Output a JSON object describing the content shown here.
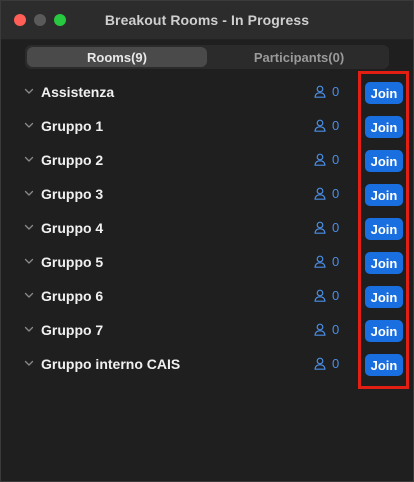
{
  "window": {
    "title": "Breakout Rooms - In Progress"
  },
  "tabs": [
    {
      "label": "Rooms(9)",
      "active": true
    },
    {
      "label": "Participants(0)",
      "active": false
    }
  ],
  "rooms": [
    {
      "name": "Assistenza",
      "count": "0",
      "join_label": "Join"
    },
    {
      "name": "Gruppo 1",
      "count": "0",
      "join_label": "Join"
    },
    {
      "name": "Gruppo 2",
      "count": "0",
      "join_label": "Join"
    },
    {
      "name": "Gruppo 3",
      "count": "0",
      "join_label": "Join"
    },
    {
      "name": "Gruppo 4",
      "count": "0",
      "join_label": "Join"
    },
    {
      "name": "Gruppo 5",
      "count": "0",
      "join_label": "Join"
    },
    {
      "name": "Gruppo 6",
      "count": "0",
      "join_label": "Join"
    },
    {
      "name": "Gruppo 7",
      "count": "0",
      "join_label": "Join"
    },
    {
      "name": "Gruppo interno CAIS",
      "count": "0",
      "join_label": "Join"
    }
  ],
  "colors": {
    "accent": "#1a6fe0",
    "count": "#4a8ee6",
    "highlight": "#e31e12",
    "background": "#1f1f1f"
  },
  "icons": {
    "chevron": "chevron-down-icon",
    "participants": "person-icon"
  }
}
